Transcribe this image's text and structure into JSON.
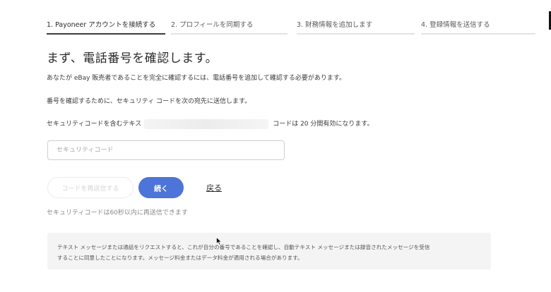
{
  "steps": [
    {
      "label": "1. Payoneer アカウントを接続する",
      "active": true
    },
    {
      "label": "2. プロフィールを同期する",
      "active": false
    },
    {
      "label": "3. 財務情報を追加します",
      "active": false
    },
    {
      "label": "4. 登録情報を送信する",
      "active": false
    }
  ],
  "main": {
    "title": "まず、電話番号を確認します。",
    "line1": "あなたが eBay 販売者であることを完全に確認するには、電話番号を追加して確認する必要があります。",
    "line2": "番号を確認するために、セキュリティ コードを次の宛先に送信します。",
    "line3_prefix": "セキュリティコードを含むテキス",
    "line3_suffix": "コードは 20 分間有効になります。",
    "code_input": {
      "placeholder": "セキュリティコード",
      "value": ""
    },
    "resend_button": "コードを再送信する",
    "continue_button": "続く",
    "back_link": "戻る",
    "resend_note": "セキュリティコードは60秒以内に再送信できます",
    "notice_line1": "テキスト メッセージまたは通話をリクエストすると、これが自分の番号であることを確認し、自動テキスト メッセージまたは録音されたメッセージを受信",
    "notice_line2": "することに同意したことになります。メッセージ料金またはデータ料金が適用される場合があります。"
  },
  "colors": {
    "primary": "#4d74d8",
    "text": "#2b2b2b",
    "notice_bg": "#f4f4f4"
  },
  "icons": {
    "pointer": "mouse-cursor-icon"
  }
}
